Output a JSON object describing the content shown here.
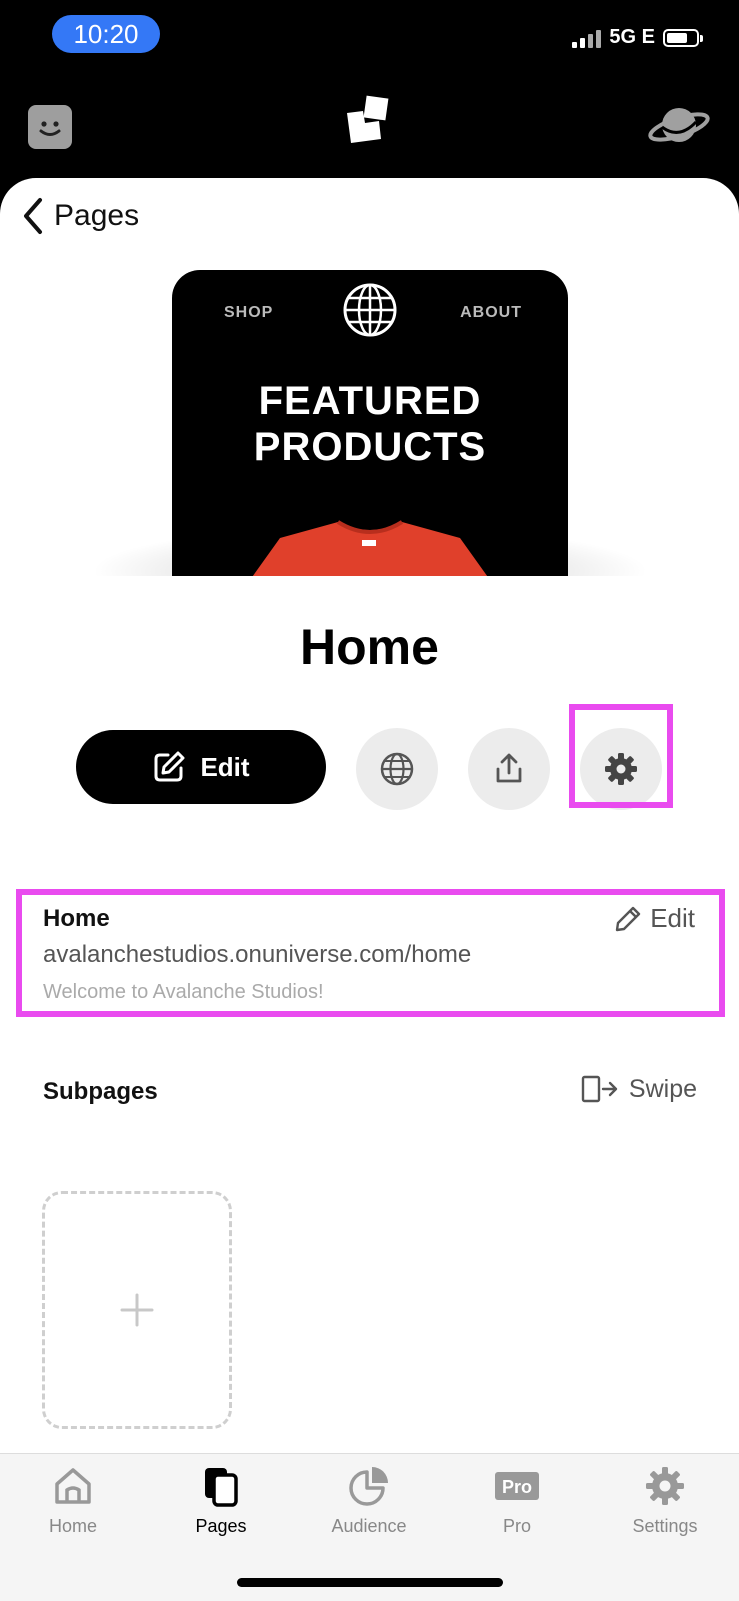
{
  "status_bar": {
    "time": "10:20",
    "network": "5G E"
  },
  "header": {
    "back_label": "Pages"
  },
  "preview": {
    "nav_left": "SHOP",
    "nav_right": "ABOUT",
    "headline_line1": "FEATURED",
    "headline_line2": "PRODUCTS"
  },
  "page": {
    "title": "Home"
  },
  "actions": {
    "edit_label": "Edit"
  },
  "info": {
    "title": "Home",
    "edit_label": "Edit",
    "url": "avalanchestudios.onuniverse.com/home",
    "description": "Welcome to Avalanche Studios!"
  },
  "subpages": {
    "title": "Subpages",
    "swipe_label": "Swipe"
  },
  "tabs": [
    {
      "label": "Home",
      "icon": "home-icon"
    },
    {
      "label": "Pages",
      "icon": "pages-icon"
    },
    {
      "label": "Audience",
      "icon": "pie-chart-icon"
    },
    {
      "label": "Pro",
      "icon": "pro-badge-icon"
    },
    {
      "label": "Settings",
      "icon": "gear-icon"
    }
  ],
  "tab_badge_text": "Pro",
  "colors": {
    "highlight": "#e94bef",
    "time_pill": "#3478f6"
  }
}
